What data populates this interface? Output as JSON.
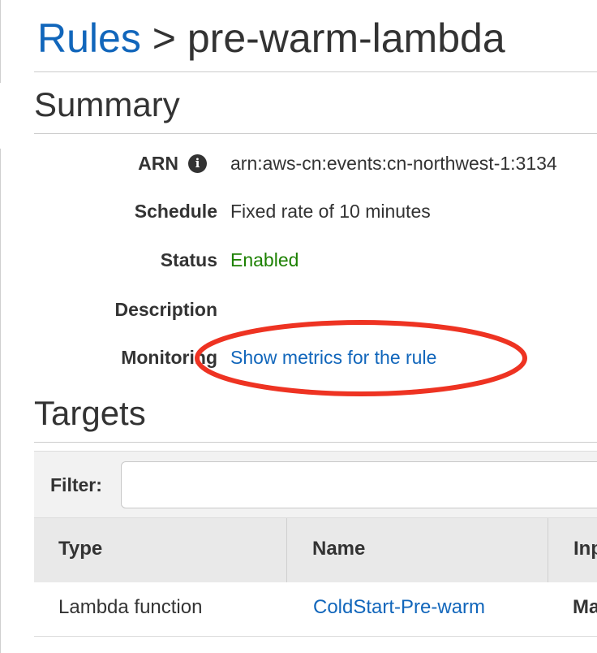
{
  "header": {
    "breadcrumb_link": "Rules",
    "separator": ">",
    "rule_name": "pre-warm-lambda"
  },
  "summary": {
    "heading": "Summary",
    "arn_label": "ARN",
    "arn_value": "arn:aws-cn:events:cn-northwest-1:3134",
    "schedule_label": "Schedule",
    "schedule_value": "Fixed rate of 10 minutes",
    "status_label": "Status",
    "status_value": "Enabled",
    "description_label": "Description",
    "description_value": "",
    "monitoring_label": "Monitoring",
    "monitoring_link": "Show metrics for the rule"
  },
  "targets": {
    "heading": "Targets",
    "filter_label": "Filter:",
    "filter_value": "",
    "columns": [
      "Type",
      "Name",
      "Inp"
    ],
    "rows": [
      {
        "type": "Lambda function",
        "name": "ColdStart-Pre-warm",
        "input": "Ma"
      }
    ]
  },
  "colors": {
    "link": "#1166bb",
    "status_enabled": "#1d8102",
    "annotation": "#ee3322"
  },
  "icons": {
    "arn_info": "info-circle-icon"
  }
}
